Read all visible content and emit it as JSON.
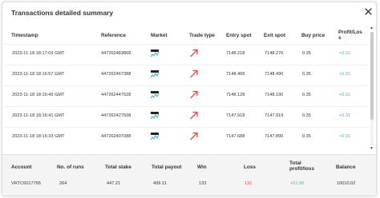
{
  "modal": {
    "title": "Transactions detailed summary",
    "close_icon": "close-icon"
  },
  "colors": {
    "profit_green": "#4bb4b3",
    "loss_red": "#e5474b",
    "arrow_red": "#e5474b",
    "summary_bg": "#f4f4f4"
  },
  "table": {
    "headers": {
      "timestamp": "Timestamp",
      "reference": "Reference",
      "market": "Market",
      "trade_type": "Trade type",
      "entry_spot": "Entry spot",
      "exit_spot": "Exit spot",
      "buy_price": "Buy price",
      "profit_loss_1": "Profit/Los",
      "profit_loss_2": "s"
    },
    "market_icon": "volatility-index-icon",
    "trade_type_icon": "rise-arrow-icon",
    "rows": [
      {
        "timestamp": "2023-11-18 18:17:03 GMT",
        "reference": "447262483868",
        "entry_spot": "7148.218",
        "exit_spot": "7148.276",
        "buy_price": "0.35",
        "profit": "+0.31"
      },
      {
        "timestamp": "2023-11-18 18:16:57 GMT",
        "reference": "447262467388",
        "entry_spot": "7148.466",
        "exit_spot": "7148.490",
        "buy_price": "0.35",
        "profit": "+0.31"
      },
      {
        "timestamp": "2023-11-18 18:16:49 GMT",
        "reference": "447262447528",
        "entry_spot": "7148.128",
        "exit_spot": "7148.190",
        "buy_price": "0.35",
        "profit": "+0.31"
      },
      {
        "timestamp": "2023-11-18 18:16:41 GMT",
        "reference": "447262427508",
        "entry_spot": "7147.918",
        "exit_spot": "7147.919",
        "buy_price": "0.35",
        "profit": "+0.31"
      },
      {
        "timestamp": "2023-11-18 18:16:33 GMT",
        "reference": "447262407088",
        "entry_spot": "7147.688",
        "exit_spot": "7147.890",
        "buy_price": "0.35",
        "profit": "+0.31"
      }
    ]
  },
  "summary": {
    "headers": {
      "account": "Account",
      "runs": "No. of runs",
      "stake": "Total stake",
      "payout": "Total payout",
      "win": "Win",
      "loss": "Loss",
      "profit_1": "Total",
      "profit_2": "profit/loss",
      "balance": "Balance"
    },
    "values": {
      "account": "VRTC6017795",
      "runs": "264",
      "stake": "447.21",
      "payout": "499.11",
      "win": "133",
      "loss": "131",
      "profit": "+51.90",
      "balance": "10010.02"
    }
  }
}
